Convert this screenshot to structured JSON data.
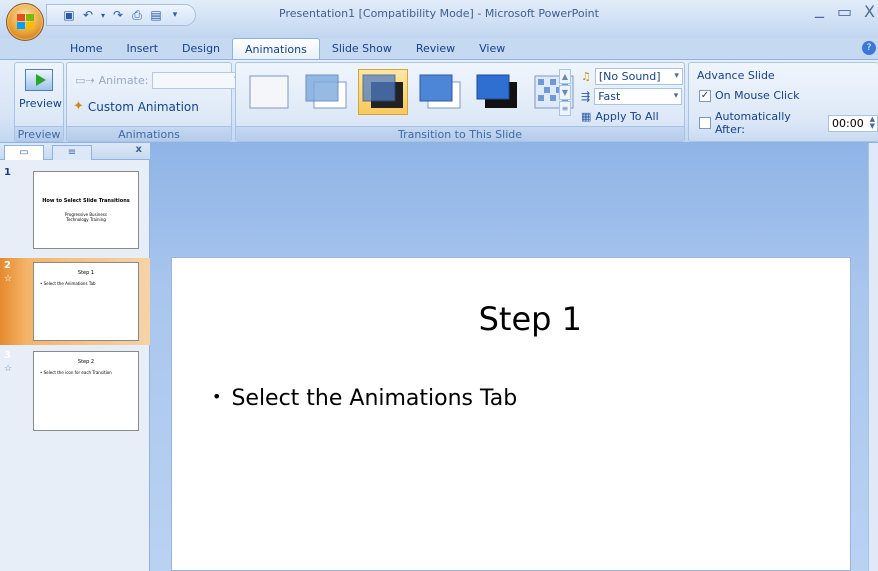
{
  "window": {
    "title": "Presentation1 [Compatibility Mode] - Microsoft PowerPoint",
    "minimize": "_",
    "maximize": "▭",
    "close": "X"
  },
  "tabs": [
    "Home",
    "Insert",
    "Design",
    "Animations",
    "Slide Show",
    "Review",
    "View"
  ],
  "active_tab": "Animations",
  "ribbon": {
    "preview_group": {
      "button": "Preview",
      "label": "Preview"
    },
    "animations_group": {
      "animate_label": "Animate:",
      "custom_animation": "Custom Animation",
      "label": "Animations"
    },
    "transition_group": {
      "label": "Transition to This Slide",
      "sound": "[No Sound]",
      "speed": "Fast",
      "apply_all": "Apply To All"
    },
    "advance_group": {
      "title": "Advance Slide",
      "on_mouse_click": "On Mouse Click",
      "automatically_after": "Automatically After:",
      "time": "00:00",
      "on_mouse_click_checked": true,
      "auto_checked": false
    }
  },
  "pane": {
    "close": "x"
  },
  "slides": [
    {
      "number": "1",
      "title": "How to Select Slide Transitions",
      "subtitle": "Progressive Business Technology Training"
    },
    {
      "number": "2",
      "title": "Step 1",
      "bullet": "• Select the Animations Tab"
    },
    {
      "number": "3",
      "title": "Step 2",
      "bullet": "• Select the icon for each Transition"
    }
  ],
  "current_slide": {
    "title": "Step 1",
    "bullet": "Select the Animations Tab"
  }
}
